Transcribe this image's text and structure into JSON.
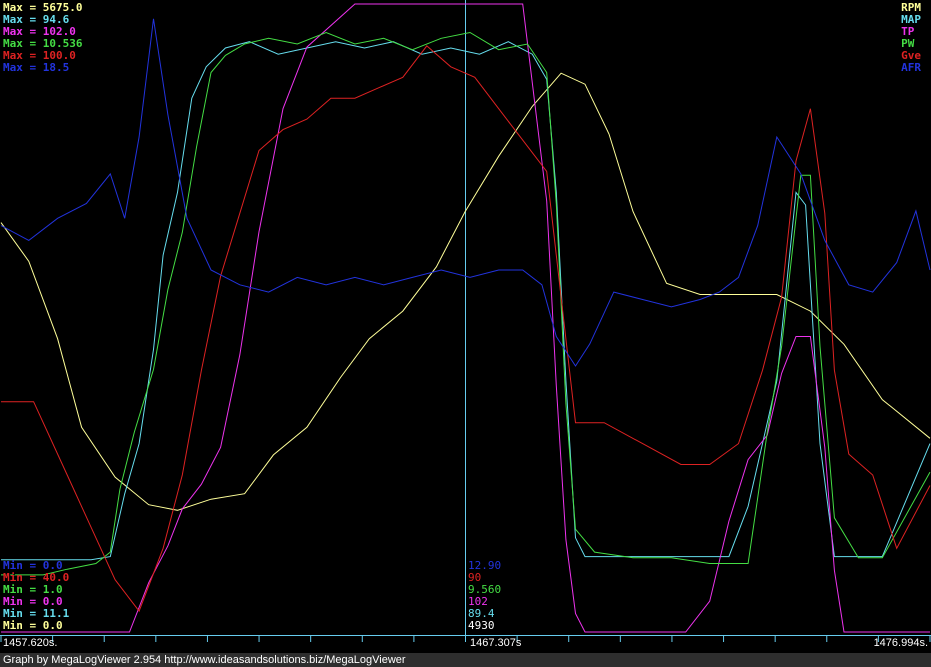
{
  "chart_data": {
    "type": "line",
    "x_unit": "s",
    "xlim": [
      1457.62,
      1476.994
    ],
    "series": [
      {
        "name": "RPM",
        "color": "#ffff99",
        "max_label": "Max = 5675.0",
        "min_label": "Min = 0.0",
        "current": "4930",
        "range": [
          0,
          5675
        ],
        "x": [
          1457.62,
          1458.2,
          1458.8,
          1459.3,
          1460.0,
          1460.7,
          1461.3,
          1462.0,
          1462.7,
          1463.3,
          1464.0,
          1464.7,
          1465.3,
          1466.0,
          1466.7,
          1467.3,
          1468.0,
          1468.7,
          1469.3,
          1469.8,
          1470.3,
          1470.8,
          1471.5,
          1472.2,
          1473.0,
          1473.8,
          1474.5,
          1475.2,
          1476.0,
          1476.994
        ],
        "values": [
          3700,
          3350,
          2650,
          1850,
          1400,
          1150,
          1100,
          1200,
          1250,
          1600,
          1850,
          2300,
          2650,
          2900,
          3300,
          3800,
          4300,
          4750,
          5050,
          4950,
          4500,
          3800,
          3150,
          3050,
          3050,
          3050,
          2900,
          2600,
          2100,
          1750
        ]
      },
      {
        "name": "MAP",
        "color": "#66ddee",
        "max_label": "Max = 94.6",
        "min_label": "Min = 11.1",
        "current": "89.4",
        "range": [
          0,
          100
        ],
        "x": [
          1457.62,
          1458.5,
          1459.0,
          1459.5,
          1459.9,
          1460.2,
          1460.5,
          1460.8,
          1461.0,
          1461.3,
          1461.6,
          1461.9,
          1462.3,
          1462.8,
          1463.4,
          1464.0,
          1464.6,
          1465.2,
          1465.8,
          1466.4,
          1467.0,
          1467.6,
          1468.2,
          1468.7,
          1469.0,
          1469.2,
          1469.4,
          1469.6,
          1469.8,
          1470.4,
          1471.0,
          1471.6,
          1472.2,
          1472.8,
          1473.2,
          1473.5,
          1473.8,
          1474.0,
          1474.2,
          1474.4,
          1474.7,
          1475.0,
          1475.5,
          1476.0,
          1476.994
        ],
        "values": [
          11.5,
          11.5,
          11.5,
          11.5,
          12,
          22,
          30,
          45,
          60,
          70,
          85,
          90,
          93,
          94,
          92,
          93,
          94,
          93,
          94,
          92,
          93,
          92,
          94,
          92,
          88,
          70,
          40,
          15,
          12,
          12,
          12,
          12,
          12,
          12,
          20,
          30,
          40,
          55,
          70,
          68,
          30,
          12,
          12,
          12,
          30
        ]
      },
      {
        "name": "TP",
        "color": "#ee33ee",
        "max_label": "Max = 102.0",
        "min_label": "Min = 0.0",
        "current": "102",
        "range": [
          0,
          102
        ],
        "x": [
          1457.62,
          1459.0,
          1459.9,
          1460.3,
          1460.7,
          1461.1,
          1461.4,
          1461.8,
          1462.2,
          1462.6,
          1463.0,
          1463.5,
          1464.0,
          1465.0,
          1466.0,
          1467.0,
          1467.5,
          1468.0,
          1468.5,
          1469.0,
          1469.2,
          1469.4,
          1469.6,
          1469.8,
          1470.2,
          1470.8,
          1471.4,
          1471.9,
          1472.4,
          1472.8,
          1473.2,
          1473.6,
          1473.9,
          1474.2,
          1474.5,
          1474.8,
          1475.0,
          1475.2,
          1475.6,
          1476.0,
          1476.994
        ],
        "values": [
          0,
          0,
          0,
          0,
          8,
          14,
          20,
          24,
          30,
          45,
          65,
          85,
          95,
          102,
          102,
          102,
          102,
          102,
          102,
          70,
          40,
          15,
          3,
          0,
          0,
          0,
          0,
          0,
          5,
          18,
          28,
          32,
          42,
          48,
          48,
          30,
          10,
          0,
          0,
          0,
          0
        ]
      },
      {
        "name": "PW",
        "color": "#44dd44",
        "max_label": "Max = 10.536",
        "min_label": "Min = 1.0",
        "current": "9.560",
        "range": [
          0,
          11
        ],
        "x": [
          1457.62,
          1458.5,
          1459.0,
          1459.6,
          1459.9,
          1460.1,
          1460.4,
          1460.8,
          1461.1,
          1461.4,
          1461.7,
          1462.0,
          1462.3,
          1462.7,
          1463.2,
          1463.8,
          1464.4,
          1465.0,
          1465.6,
          1466.2,
          1466.8,
          1467.4,
          1468.0,
          1468.6,
          1469.0,
          1469.2,
          1469.4,
          1469.6,
          1470.0,
          1470.8,
          1471.6,
          1472.4,
          1473.2,
          1473.6,
          1473.9,
          1474.1,
          1474.3,
          1474.5,
          1474.7,
          1475.0,
          1475.5,
          1476.0,
          1476.994
        ],
        "values": [
          1.0,
          1.0,
          1.1,
          1.2,
          1.4,
          2.5,
          3.5,
          4.6,
          6.0,
          7.0,
          8.5,
          9.8,
          10.1,
          10.3,
          10.4,
          10.3,
          10.5,
          10.3,
          10.4,
          10.2,
          10.4,
          10.5,
          10.2,
          10.3,
          9.8,
          7.5,
          4.0,
          1.8,
          1.4,
          1.3,
          1.3,
          1.2,
          1.2,
          3.5,
          5.0,
          6.5,
          8.0,
          8.0,
          5.0,
          2.0,
          1.3,
          1.3,
          2.8
        ]
      },
      {
        "name": "Gve",
        "color": "#dd2222",
        "max_label": "Max = 100.0",
        "min_label": "Min = 40.0",
        "current": "90",
        "range": [
          40,
          100
        ],
        "x": [
          1457.62,
          1458.3,
          1459.0,
          1459.5,
          1460.0,
          1460.5,
          1461.0,
          1461.4,
          1461.8,
          1462.2,
          1462.6,
          1463.0,
          1463.5,
          1464.0,
          1464.5,
          1465.0,
          1465.5,
          1466.0,
          1466.5,
          1467.0,
          1467.5,
          1468.0,
          1468.5,
          1469.0,
          1469.3,
          1469.6,
          1470.2,
          1471.0,
          1471.8,
          1472.4,
          1473.0,
          1473.5,
          1473.9,
          1474.2,
          1474.5,
          1474.8,
          1475.0,
          1475.3,
          1475.8,
          1476.3,
          1476.994
        ],
        "values": [
          62,
          62,
          55,
          50,
          45,
          42,
          48,
          55,
          65,
          74,
          80,
          86,
          88,
          89,
          91,
          91,
          92,
          93,
          96,
          94,
          93,
          90,
          87,
          84,
          72,
          60,
          60,
          58,
          56,
          56,
          58,
          65,
          72,
          85,
          90,
          80,
          65,
          57,
          55,
          48,
          54
        ]
      },
      {
        "name": "AFR",
        "color": "#2233dd",
        "max_label": "Max = 18.5",
        "min_label": "Min = 0.0",
        "current": "12.90",
        "range": [
          10,
          18.5
        ],
        "x": [
          1457.62,
          1458.2,
          1458.8,
          1459.4,
          1459.9,
          1460.2,
          1460.5,
          1460.8,
          1461.1,
          1461.5,
          1462.0,
          1462.6,
          1463.2,
          1463.8,
          1464.4,
          1465.0,
          1465.6,
          1466.2,
          1466.8,
          1467.4,
          1468.0,
          1468.5,
          1468.9,
          1469.2,
          1469.6,
          1469.9,
          1470.4,
          1471.0,
          1471.6,
          1472.2,
          1472.6,
          1473.0,
          1473.4,
          1473.8,
          1474.3,
          1474.8,
          1475.3,
          1475.8,
          1476.3,
          1476.7,
          1476.994
        ],
        "values": [
          15.5,
          15.3,
          15.6,
          15.8,
          16.2,
          15.6,
          16.7,
          18.3,
          17.0,
          15.6,
          14.9,
          14.7,
          14.6,
          14.8,
          14.7,
          14.8,
          14.7,
          14.8,
          14.9,
          14.8,
          14.9,
          14.9,
          14.7,
          14.0,
          13.6,
          13.9,
          14.6,
          14.5,
          14.4,
          14.5,
          14.6,
          14.8,
          15.5,
          16.7,
          16.2,
          15.3,
          14.7,
          14.6,
          15.0,
          15.7,
          14.9
        ]
      }
    ],
    "cursor_x": 1467.307,
    "x_tick_labels": {
      "left": "1457.620s.",
      "center": "1467.307s",
      "right": "1476.994s."
    }
  },
  "footer": {
    "text": "Graph by MegaLogViewer 2.954 http://www.ideasandsolutions.biz/MegaLogViewer"
  }
}
